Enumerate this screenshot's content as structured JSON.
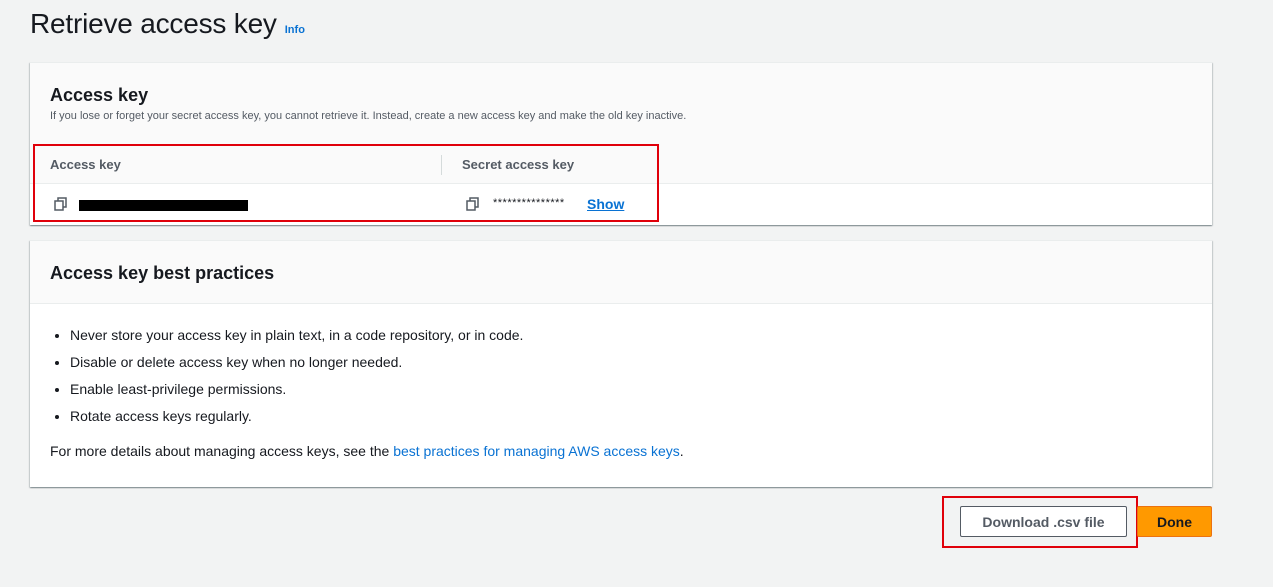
{
  "header": {
    "title": "Retrieve access key",
    "info_label": "Info"
  },
  "access_key_panel": {
    "title": "Access key",
    "description": "If you lose or forget your secret access key, you cannot retrieve it. Instead, create a new access key and make the old key inactive.",
    "columns": [
      "Access key",
      "Secret access key"
    ],
    "secret_value": "***************",
    "show_label": "Show"
  },
  "best_practices_panel": {
    "title": "Access key best practices",
    "items": [
      "Never store your access key in plain text, in a code repository, or in code.",
      "Disable or delete access key when no longer needed.",
      "Enable least-privilege permissions.",
      "Rotate access keys regularly."
    ],
    "footnote_prefix": "For more details about managing access keys, see the ",
    "footnote_link": "best practices for managing AWS access keys",
    "footnote_suffix": "."
  },
  "actions": {
    "download_label": "Download .csv file",
    "done_label": "Done"
  },
  "colors": {
    "accent_link": "#0972d3",
    "primary_button": "#ff9900",
    "highlight": "#e0000a"
  }
}
